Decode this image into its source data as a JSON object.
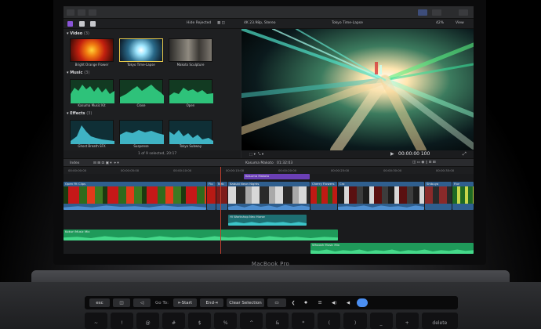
{
  "device": {
    "brand": "MacBook Pro"
  },
  "app": {
    "toolbar": {
      "hide_rejected": "Hide Rejected",
      "format": "4K 23.98p, Stereo",
      "project_title": "Tokyo Time-Lapse",
      "zoom": "42%",
      "view": "View"
    },
    "browser": {
      "sections": [
        {
          "label": "Video",
          "count": "(3)",
          "clips": [
            "Bright Orange Flower",
            "Tokyo Time-Lapse",
            "Makoto Sculpture"
          ]
        },
        {
          "label": "Music",
          "count": "(3)",
          "clips": [
            "Kasuma Music Kit",
            "Close",
            "Open"
          ]
        },
        {
          "label": "Effects",
          "count": "(3)",
          "clips": [
            "Ghost Breath SFX",
            "Suspense",
            "Tokyo Subway"
          ]
        }
      ],
      "status": "1 of 9 selected, 20:17"
    },
    "viewer": {
      "timecode": "00:00:00 100"
    },
    "timeline": {
      "index_label": "Index",
      "project_name": "Kasuma Makoto",
      "duration": "01:32:03",
      "ruler": [
        "00:00:00:00",
        "00:00:05:00",
        "00:00:10:00",
        "00:00:15:00",
        "00:00:20:00",
        "00:00:25:00",
        "00:00:30:00",
        "00:00:35:00"
      ],
      "title_clip": "Kasuma Makoto",
      "video_clips": [
        "Open Fit Clips",
        "Flo",
        "Neb",
        "Kabuki Neon Nights",
        "Cherry Flowers",
        "Cro",
        "Shibuya",
        "Flor"
      ],
      "mid_clip": "Hi Workshop Neo Horse",
      "music_clips": [
        "Kokuri Music Mix",
        "Whoosh Music Mix"
      ]
    }
  },
  "touchbar": {
    "esc": "esc",
    "go_to": "Go To:",
    "start": "Start",
    "end": "End",
    "clear_selection": "Clear Selection"
  },
  "keyboard": {
    "delete": "delete"
  },
  "colors": {
    "accent": "#e6c84a",
    "video_clip": "#2f5f8f",
    "audio_clip": "#1f9a5a",
    "title_clip": "#6a3fb5",
    "playhead": "#c2402f"
  }
}
